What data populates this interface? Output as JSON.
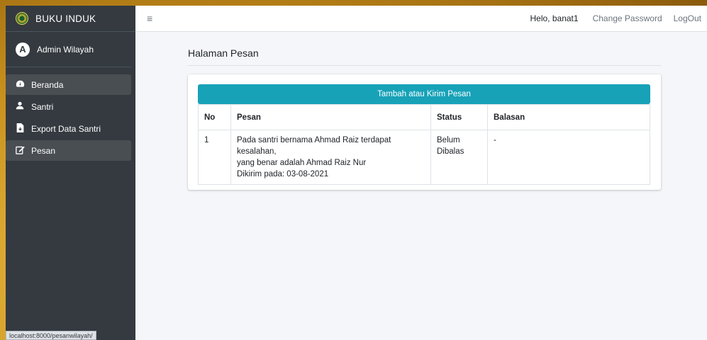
{
  "brand": {
    "name": "BUKU INDUK"
  },
  "user_panel": {
    "avatar_letter": "A",
    "name": "Admin Wilayah"
  },
  "sidebar": {
    "items": [
      {
        "label": "Beranda",
        "icon": "dashboard-icon"
      },
      {
        "label": "Santri",
        "icon": "user-icon"
      },
      {
        "label": "Export Data Santri",
        "icon": "file-export-icon"
      },
      {
        "label": "Pesan",
        "icon": "edit-icon"
      }
    ]
  },
  "topbar": {
    "menu_icon": "hamburger-icon",
    "greeting": "Helo, banat1",
    "change_password": "Change Password",
    "logout": "LogOut"
  },
  "page": {
    "title": "Halaman Pesan",
    "add_button": "Tambah atau Kirim Pesan"
  },
  "table": {
    "headers": {
      "no": "No",
      "pesan": "Pesan",
      "status": "Status",
      "balasan": "Balasan"
    },
    "rows": [
      {
        "no": "1",
        "pesan_line1": "Pada santri bernama Ahmad Raiz terdapat kesalahan,",
        "pesan_line2": "yang benar adalah Ahmad Raiz Nur",
        "pesan_line3": "Dikirim pada: 03-08-2021",
        "status_line1": "Belum",
        "status_line2": "Dibalas",
        "balasan": "-"
      }
    ]
  },
  "status_bar": {
    "url": "localhost:8000/pesanwilayah/"
  },
  "colors": {
    "sidebar_bg": "#343a40",
    "accent": "#17a2b8",
    "content_bg": "#f4f6f9"
  }
}
